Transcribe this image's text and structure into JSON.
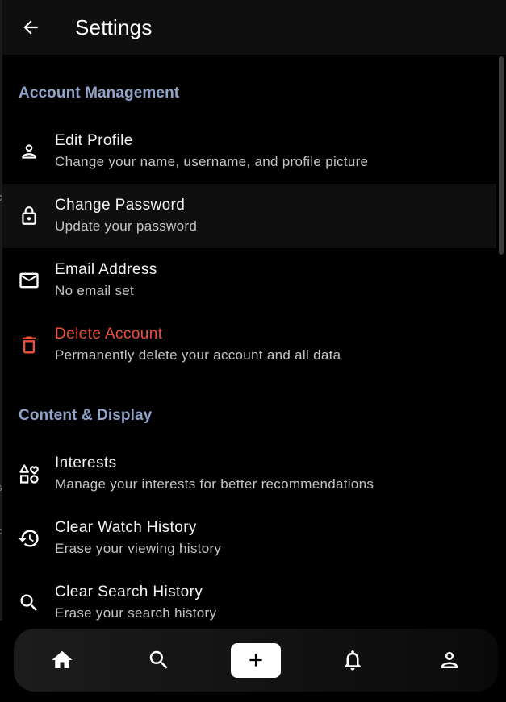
{
  "appbar": {
    "title": "Settings",
    "back_icon": "arrow-back-icon"
  },
  "sections": [
    {
      "header": "Account Management",
      "items": [
        {
          "icon": "person-icon",
          "title": "Edit Profile",
          "subtitle": "Change your name, username, and profile picture"
        },
        {
          "icon": "lock-icon",
          "title": "Change Password",
          "subtitle": "Update your password"
        },
        {
          "icon": "mail-icon",
          "title": "Email Address",
          "subtitle": "No email set"
        },
        {
          "icon": "trash-icon",
          "title": "Delete Account",
          "subtitle": "Permanently delete your account and all data"
        }
      ]
    },
    {
      "header": "Content & Display",
      "items": [
        {
          "icon": "interests-icon",
          "title": "Interests",
          "subtitle": "Manage your interests for better recommendations"
        },
        {
          "icon": "history-icon",
          "title": "Clear Watch History",
          "subtitle": "Erase your viewing history"
        },
        {
          "icon": "search-icon",
          "title": "Clear Search History",
          "subtitle": "Erase your search history"
        }
      ]
    }
  ],
  "bottom_nav": {
    "items": [
      {
        "icon": "home-icon"
      },
      {
        "icon": "search-icon"
      },
      {
        "icon": "add-icon"
      },
      {
        "icon": "bell-icon"
      },
      {
        "icon": "profile-icon"
      }
    ]
  },
  "colors": {
    "background": "#000000",
    "appbar": "#0f0f0f",
    "section_header": "#8fa4c8",
    "danger": "#ef4e3d",
    "subtitle": "#c4c4c4",
    "highlight_row": "#0f0f0f"
  }
}
